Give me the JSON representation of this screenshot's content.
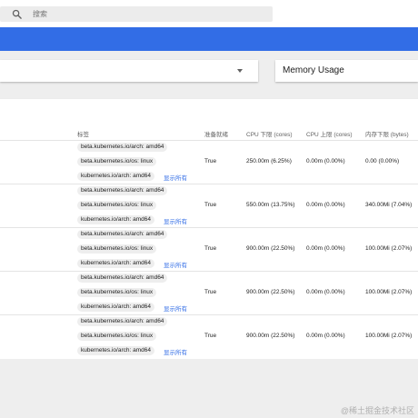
{
  "search": {
    "placeholder": "搜索"
  },
  "filters": {
    "metric_label": "Memory Usage"
  },
  "table": {
    "columns": [
      "标签",
      "准备就绪",
      "CPU 下限 (cores)",
      "CPU 上限 (cores)",
      "内存下限 (bytes)"
    ],
    "show_all_label": "显示所有",
    "rows": [
      {
        "labels": [
          "beta.kubernetes.io/arch: amd64",
          "beta.kubernetes.io/os: linux",
          "kubernetes.io/arch: amd64"
        ],
        "ready": "True",
        "cpu_requests": "250.00m (6.25%)",
        "cpu_limits": "0.00m (0.00%)",
        "memory_requests": "0.00 (0.00%)"
      },
      {
        "labels": [
          "beta.kubernetes.io/arch: amd64",
          "beta.kubernetes.io/os: linux",
          "kubernetes.io/arch: amd64"
        ],
        "ready": "True",
        "cpu_requests": "550.00m (13.75%)",
        "cpu_limits": "0.00m (0.00%)",
        "memory_requests": "340.00Mi (7.04%)"
      },
      {
        "labels": [
          "beta.kubernetes.io/arch: amd64",
          "beta.kubernetes.io/os: linux",
          "kubernetes.io/arch: amd64"
        ],
        "ready": "True",
        "cpu_requests": "900.00m (22.50%)",
        "cpu_limits": "0.00m (0.00%)",
        "memory_requests": "100.00Mi (2.07%)"
      },
      {
        "labels": [
          "beta.kubernetes.io/arch: amd64",
          "beta.kubernetes.io/os: linux",
          "kubernetes.io/arch: amd64"
        ],
        "ready": "True",
        "cpu_requests": "900.00m (22.50%)",
        "cpu_limits": "0.00m (0.00%)",
        "memory_requests": "100.00Mi (2.07%)"
      },
      {
        "labels": [
          "beta.kubernetes.io/arch: amd64",
          "beta.kubernetes.io/os: linux",
          "kubernetes.io/arch: amd64"
        ],
        "ready": "True",
        "cpu_requests": "900.00m (22.50%)",
        "cpu_limits": "0.00m (0.00%)",
        "memory_requests": "100.00Mi (2.07%)"
      }
    ]
  },
  "watermark": "@稀土掘金技术社区",
  "colors": {
    "brand_blue": "#326de6",
    "background_gray": "#eeeeee",
    "chip_gray": "#eeeeee"
  }
}
